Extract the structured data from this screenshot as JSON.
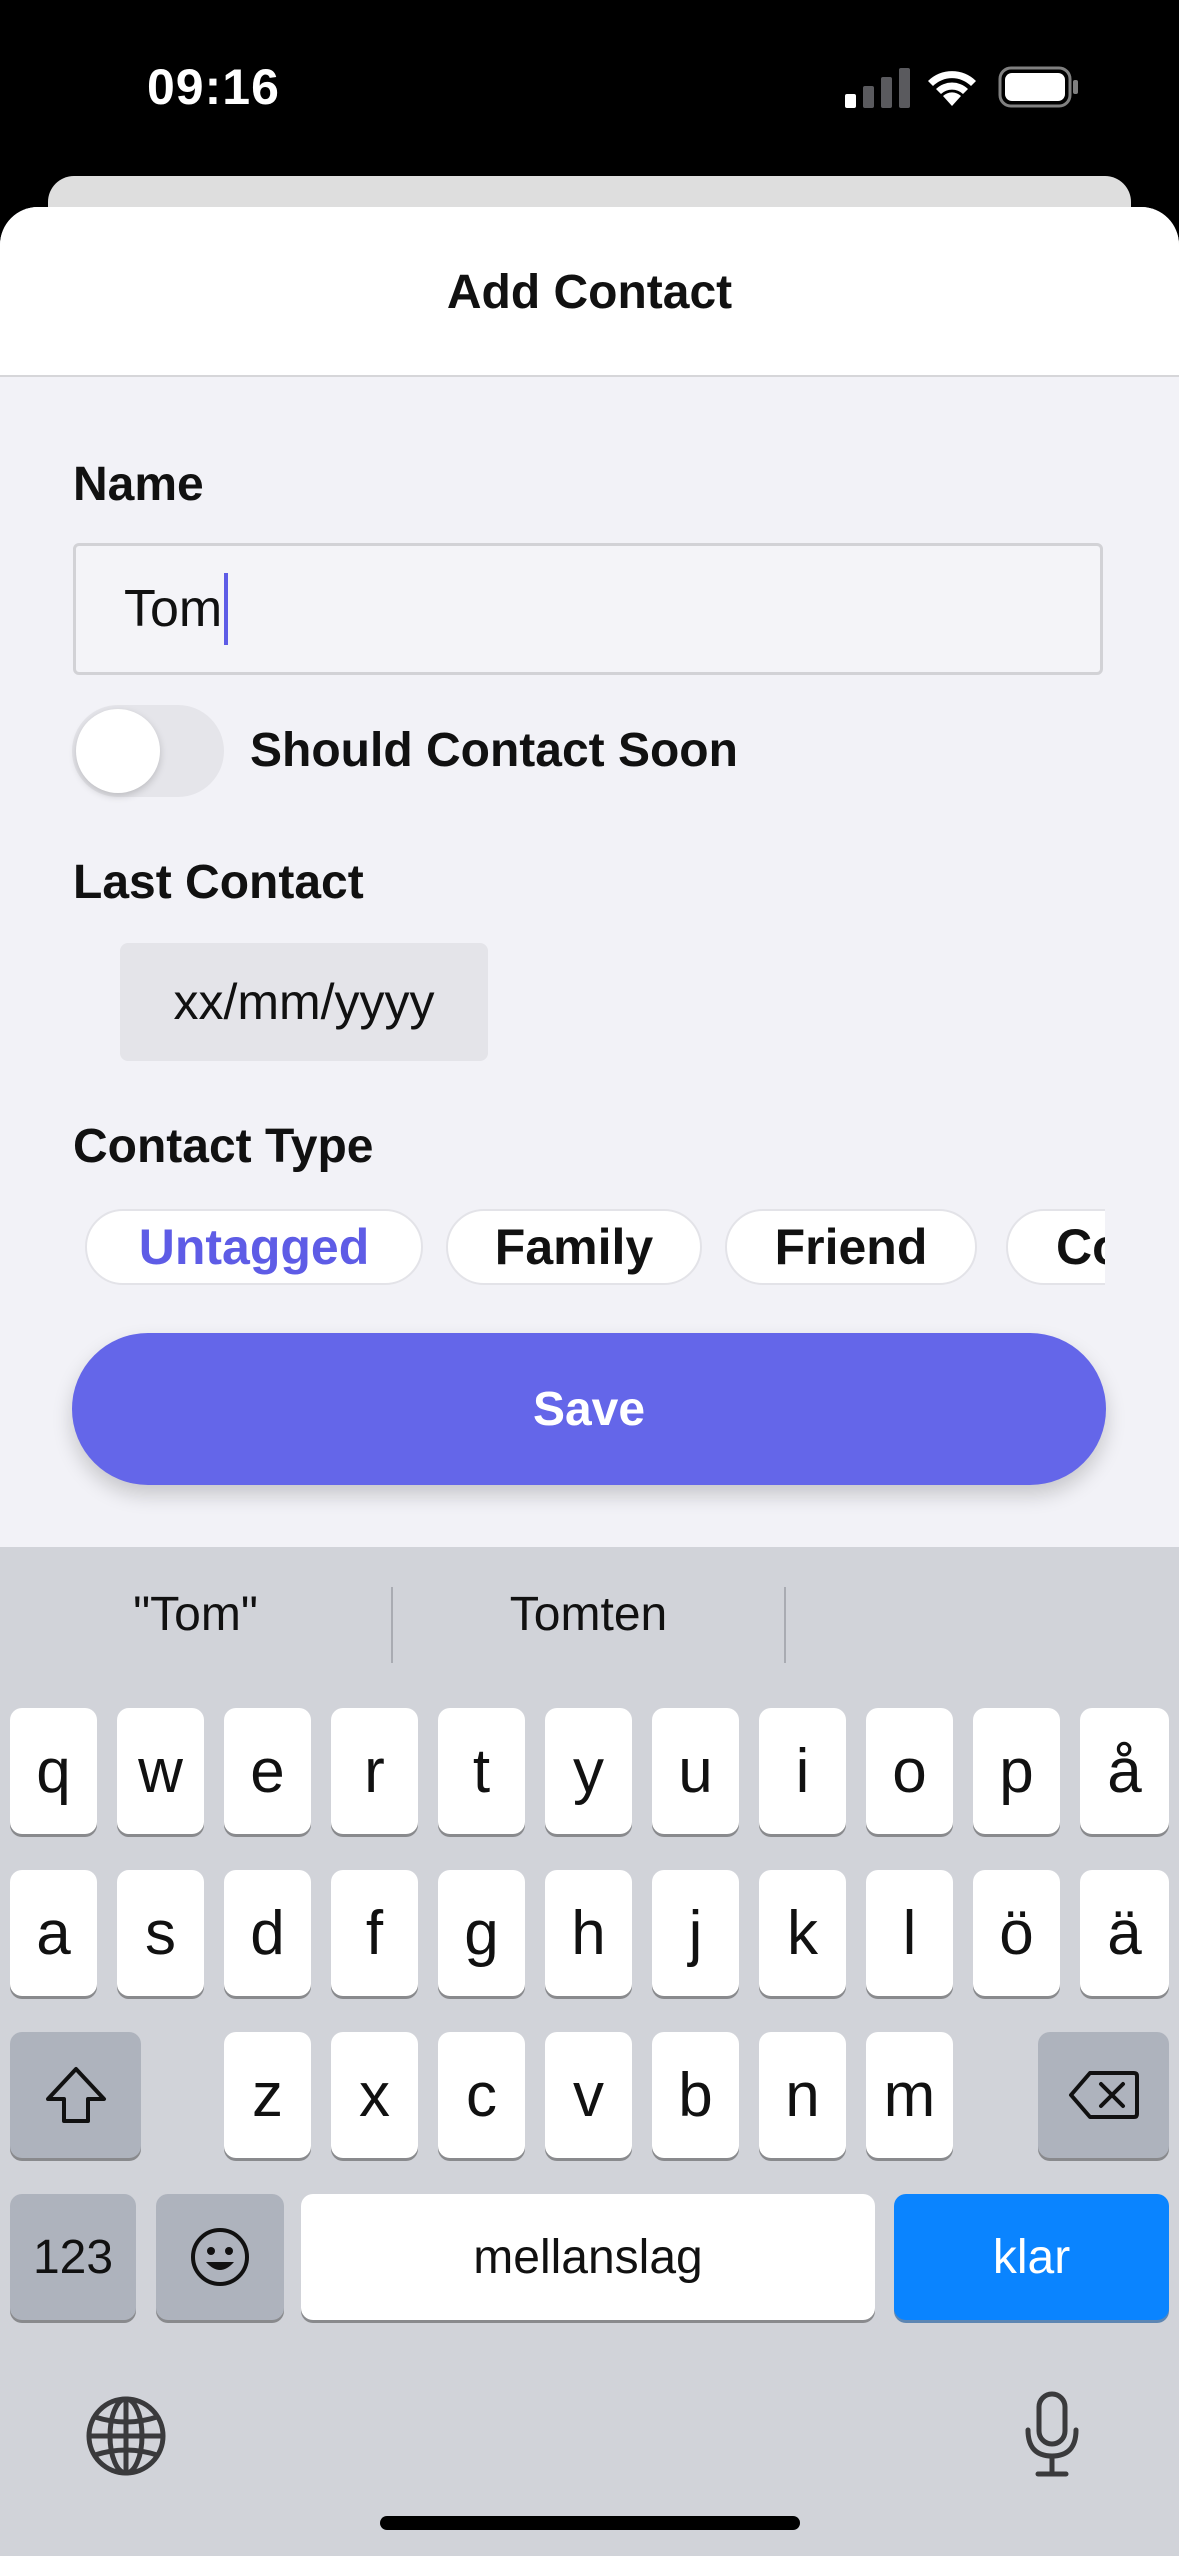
{
  "status_bar": {
    "time": "09:16",
    "signal_icon": "cellular-signal-icon",
    "wifi_icon": "wifi-icon",
    "battery_icon": "battery-icon"
  },
  "sheet": {
    "title": "Add Contact",
    "name_label": "Name",
    "name_value": "Tom",
    "toggle_label": "Should Contact Soon",
    "toggle_on": false,
    "last_contact_label": "Last Contact",
    "last_contact_value": "xx/mm/yyyy",
    "contact_type_label": "Contact Type",
    "contact_types": [
      {
        "label": "Untagged",
        "selected": true
      },
      {
        "label": "Family",
        "selected": false
      },
      {
        "label": "Friend",
        "selected": false
      },
      {
        "label": "Co",
        "selected": false
      }
    ],
    "save_label": "Save",
    "accent_color": "#6466e9"
  },
  "keyboard": {
    "suggestions": [
      "\"Tom\"",
      "Tomten",
      ""
    ],
    "row1": [
      "q",
      "w",
      "e",
      "r",
      "t",
      "y",
      "u",
      "i",
      "o",
      "p",
      "å"
    ],
    "row2": [
      "a",
      "s",
      "d",
      "f",
      "g",
      "h",
      "j",
      "k",
      "l",
      "ö",
      "ä"
    ],
    "row3": [
      "z",
      "x",
      "c",
      "v",
      "b",
      "n",
      "m"
    ],
    "shift_icon": "shift-icon",
    "delete_icon": "delete-backspace-icon",
    "numbers_label": "123",
    "emoji_icon": "emoji-icon",
    "space_label": "mellanslag",
    "return_label": "klar",
    "globe_icon": "globe-icon",
    "mic_icon": "microphone-icon"
  }
}
